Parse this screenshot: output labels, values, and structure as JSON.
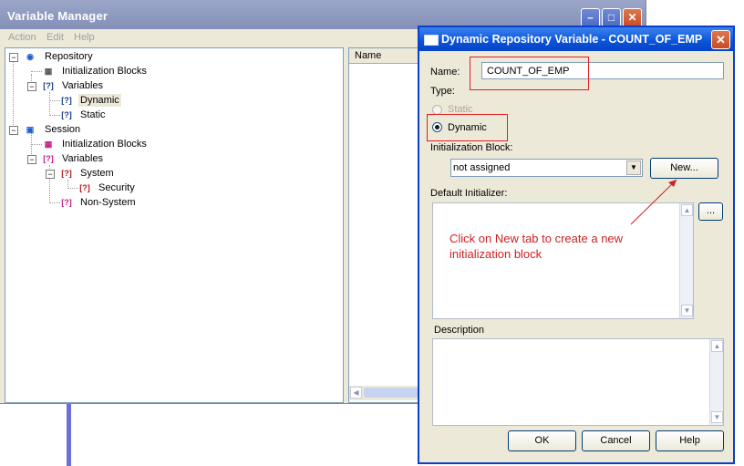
{
  "variable_manager": {
    "title": "Variable Manager",
    "menu": [
      "Action",
      "Edit",
      "Help"
    ],
    "tree": {
      "repository": "Repository",
      "repo_init_blocks": "Initialization Blocks",
      "repo_variables": "Variables",
      "dynamic": "Dynamic",
      "static": "Static",
      "session": "Session",
      "session_init_blocks": "Initialization Blocks",
      "session_variables": "Variables",
      "system": "System",
      "security": "Security",
      "non_system": "Non-System"
    },
    "list_header": "Name"
  },
  "dialog": {
    "title": "Dynamic Repository Variable - COUNT_OF_EMP",
    "name_label": "Name:",
    "name_value": "COUNT_OF_EMP",
    "type_label": "Type:",
    "static_option": "Static",
    "dynamic_option": "Dynamic",
    "init_block_label": "Initialization Block:",
    "init_block_value": "not assigned",
    "new_button": "New...",
    "default_init_label": "Default Initializer:",
    "ellipsis_button": "...",
    "description_label": "Description",
    "ok_button": "OK",
    "cancel_button": "Cancel",
    "help_button": "Help"
  },
  "annotation": {
    "line1": "Click on New tab to create a new",
    "line2": "initialization block"
  },
  "colors": {
    "annotation": "#cc2222",
    "dialog_title": "#0a53d8",
    "inactive_title": "#8590b8"
  }
}
